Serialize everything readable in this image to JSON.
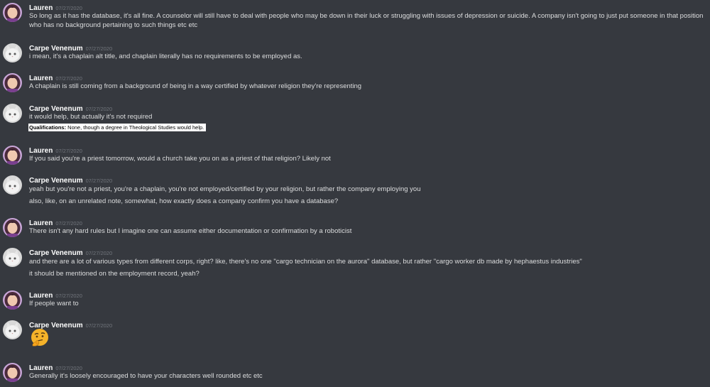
{
  "users": {
    "lauren": {
      "name": "Lauren"
    },
    "carpe": {
      "name": "Carpe Venenum"
    }
  },
  "messages": [
    {
      "author": "Lauren",
      "timestamp": "07/27/2020",
      "lines": [
        "So long as it has the database, it's all fine. A counselor will still have to deal with people who may be down in their luck or struggling with issues of depression or suicide. A company isn't going to just put someone in that position who has no background pertaining to such things etc etc"
      ]
    },
    {
      "author": "Carpe Venenum",
      "timestamp": "07/27/2020",
      "lines": [
        "i mean, it's a chaplain alt title, and chaplain literally has no requirements to be employed as."
      ]
    },
    {
      "author": "Lauren",
      "timestamp": "07/27/2020",
      "lines": [
        "A chaplain is still coming from a background of being in a way certified by whatever religion they're representing"
      ]
    },
    {
      "author": "Carpe Venenum",
      "timestamp": "07/27/2020",
      "lines": [
        "it would help, but actually it's not required"
      ],
      "embed": {
        "label": "Qualifications:",
        "text": " None, though a degree in Theological Studies would help."
      }
    },
    {
      "author": "Lauren",
      "timestamp": "07/27/2020",
      "lines": [
        "If you said you're a priest tomorrow, would a church take you on as a priest of that religion? Likely not"
      ]
    },
    {
      "author": "Carpe Venenum",
      "timestamp": "07/27/2020",
      "lines": [
        "yeah but you're not a priest, you're a chaplain, you're not employed/certified by your religion, but rather the company employing you",
        "also, like, on an unrelated note, somewhat, how exactly does a company confirm you have a database?"
      ]
    },
    {
      "author": "Lauren",
      "timestamp": "07/27/2020",
      "lines": [
        "There isn't any hard rules but I imagine one can assume either documentation or confirmation by a roboticist"
      ]
    },
    {
      "author": "Carpe Venenum",
      "timestamp": "07/27/2020",
      "lines": [
        "and there are a lot of various types from different corps, right? like, there's no one \"cargo technician on the aurora\" database, but rather \"cargo worker db made by hephaestus industries\"",
        "it should be mentioned on the employment record, yeah?"
      ]
    },
    {
      "author": "Lauren",
      "timestamp": "07/27/2020",
      "lines": [
        "If people want to"
      ]
    },
    {
      "author": "Carpe Venenum",
      "timestamp": "07/27/2020",
      "emoji": "thinking-face-emoji"
    },
    {
      "author": "Lauren",
      "timestamp": "07/27/2020",
      "lines": [
        "Generally it's loosely encouraged to have your characters well rounded etc etc"
      ]
    }
  ]
}
